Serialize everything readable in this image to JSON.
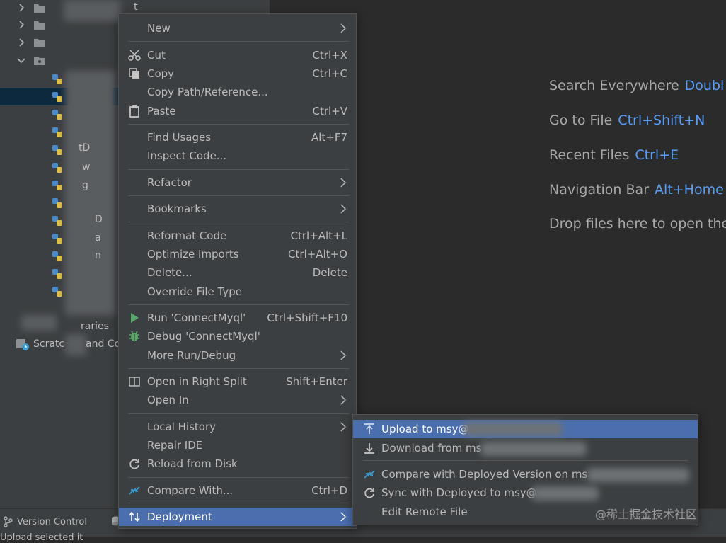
{
  "project_tree": {
    "fragments": [
      "t",
      "tD",
      "w",
      "g",
      "D",
      "a",
      "n"
    ],
    "libraries_label": "raries",
    "scratches_label": "Scratc",
    "scratches_suffix": "and Co"
  },
  "context_menu": {
    "items": [
      {
        "label": "New",
        "submenu": true
      },
      {
        "label": "Cut",
        "shortcut": "Ctrl+X",
        "icon": "scissors-icon"
      },
      {
        "label": "Copy",
        "shortcut": "Ctrl+C",
        "icon": "copy-icon"
      },
      {
        "label": "Copy Path/Reference..."
      },
      {
        "label": "Paste",
        "shortcut": "Ctrl+V",
        "icon": "clipboard-icon"
      },
      {
        "label": "Find Usages",
        "shortcut": "Alt+F7"
      },
      {
        "label": "Inspect Code..."
      },
      {
        "label": "Refactor",
        "submenu": true
      },
      {
        "label": "Bookmarks",
        "submenu": true
      },
      {
        "label": "Reformat Code",
        "shortcut": "Ctrl+Alt+L"
      },
      {
        "label": "Optimize Imports",
        "shortcut": "Ctrl+Alt+O"
      },
      {
        "label": "Delete...",
        "shortcut": "Delete"
      },
      {
        "label": "Override File Type"
      },
      {
        "label": "Run 'ConnectMyql'",
        "shortcut": "Ctrl+Shift+F10",
        "icon": "run-icon"
      },
      {
        "label": "Debug 'ConnectMyql'",
        "icon": "debug-icon"
      },
      {
        "label": "More Run/Debug",
        "submenu": true
      },
      {
        "label": "Open in Right Split",
        "shortcut": "Shift+Enter",
        "icon": "split-icon"
      },
      {
        "label": "Open In",
        "submenu": true
      },
      {
        "label": "Local History",
        "submenu": true
      },
      {
        "label": "Repair IDE"
      },
      {
        "label": "Reload from Disk",
        "icon": "reload-icon"
      },
      {
        "label": "Compare With...",
        "shortcut": "Ctrl+D",
        "icon": "compare-icon"
      },
      {
        "label": "Deployment",
        "submenu": true,
        "icon": "deployment-icon",
        "active": true
      }
    ]
  },
  "deployment_submenu": {
    "items": [
      {
        "label": "Upload to msy@",
        "icon": "upload-icon",
        "active": true
      },
      {
        "label": "Download from ms",
        "icon": "download-icon"
      },
      {
        "label": "Compare with Deployed Version on ms",
        "icon": "compare-icon"
      },
      {
        "label": "Sync with Deployed to msy@",
        "icon": "sync-icon"
      },
      {
        "label": "Edit Remote File"
      }
    ]
  },
  "editor_hints": [
    {
      "text": "Search Everywhere",
      "key": "Doubl"
    },
    {
      "text": "Go to File",
      "key": "Ctrl+Shift+N"
    },
    {
      "text": "Recent Files",
      "key": "Ctrl+E"
    },
    {
      "text": "Navigation Bar",
      "key": "Alt+Home"
    },
    {
      "text": "Drop files here to open the",
      "key": ""
    }
  ],
  "bottom_bar": {
    "version_control": "Version Control",
    "status": "Upload selected it"
  },
  "watermark": "@稀土掘金技术社区",
  "colors": {
    "panel_bg": "#3c3f41",
    "editor_bg": "#2b2b2b",
    "selection": "#4b6eaf",
    "tree_selection": "#0d293e",
    "shortcut_key": "#589df6"
  }
}
